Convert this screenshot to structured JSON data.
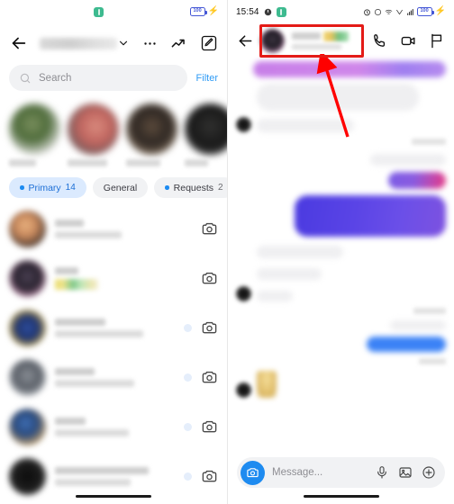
{
  "left_panel": {
    "status_bar": {
      "center_icon": "green-app-badge",
      "battery_text": "100",
      "charging": "⚡"
    },
    "header": {
      "back_icon": "back-arrow-icon",
      "account_name": "",
      "chevron_icon": "chevron-down-icon",
      "more_icon": "more-options-icon",
      "trending_icon": "trending-arrow-icon",
      "compose_icon": "compose-icon"
    },
    "search": {
      "icon": "search-icon",
      "placeholder": "Search",
      "filter_label": "Filter"
    },
    "stories": [
      {
        "name": "",
        "avatar": "story-avatar-1"
      },
      {
        "name": "",
        "avatar": "story-avatar-2"
      },
      {
        "name": "",
        "avatar": "story-avatar-3"
      },
      {
        "name": "",
        "avatar": "story-avatar-4"
      }
    ],
    "tabs": [
      {
        "label": "Primary",
        "count": "14",
        "dot": true,
        "active": true
      },
      {
        "label": "General",
        "count": "",
        "dot": false,
        "active": false
      },
      {
        "label": "Requests",
        "count": "2",
        "dot": true,
        "active": false
      }
    ],
    "chats": [
      {
        "name": "",
        "preview": "",
        "unread": false,
        "camera_icon": "camera-icon"
      },
      {
        "name": "",
        "preview": "",
        "unread": false,
        "camera_icon": "camera-icon"
      },
      {
        "name": "",
        "preview": "",
        "unread": true,
        "camera_icon": "camera-icon"
      },
      {
        "name": "",
        "preview": "",
        "unread": true,
        "camera_icon": "camera-icon"
      },
      {
        "name": "",
        "preview": "",
        "unread": true,
        "camera_icon": "camera-icon"
      },
      {
        "name": "",
        "preview": "",
        "unread": true,
        "camera_icon": "camera-icon"
      }
    ]
  },
  "right_panel": {
    "status_bar": {
      "time": "15:54",
      "icons": [
        "power-icon",
        "green-app-badge",
        "alarm-icon",
        "clock-icon",
        "wifi-icon",
        "network-icon",
        "signal-icon"
      ],
      "battery_text": "100",
      "charging": "⚡"
    },
    "header": {
      "back_icon": "back-arrow-icon",
      "contact_name": "",
      "contact_status": "",
      "call_icon": "phone-call-icon",
      "video_icon": "video-call-icon",
      "flag_icon": "flag-icon"
    },
    "annotation": {
      "box_color": "#e41b17",
      "arrow_color": "#ff0000",
      "target": "chat-header-profile"
    },
    "composer": {
      "camera_icon": "camera-icon",
      "placeholder": "Message...",
      "mic_icon": "microphone-icon",
      "gallery_icon": "image-gallery-icon",
      "plus_icon": "plus-icon"
    }
  }
}
